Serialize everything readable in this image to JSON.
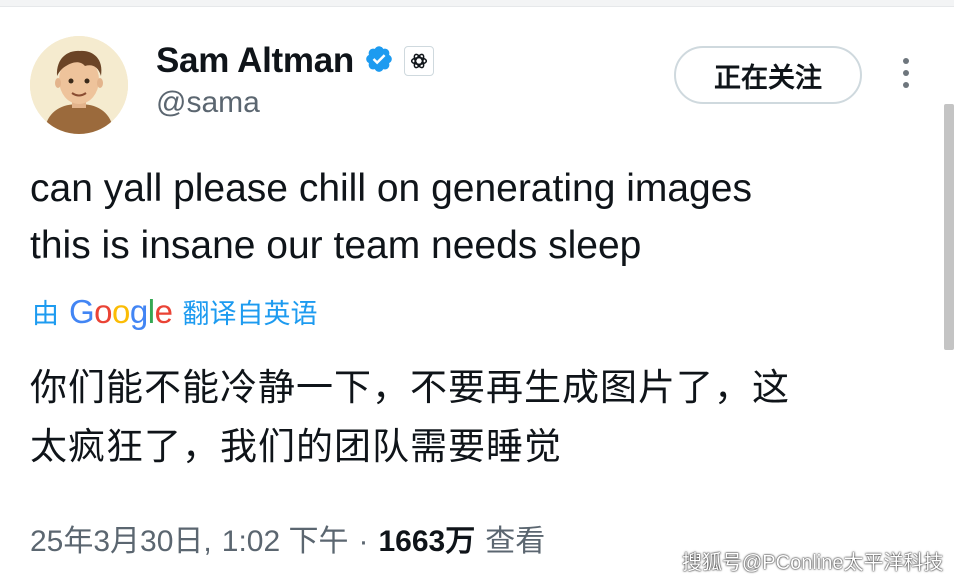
{
  "author": {
    "display_name": "Sam Altman",
    "handle": "@sama",
    "verified_icon": "verified-badge-icon",
    "affiliation_icon": "openai-logo-icon",
    "avatar_icon": "cartoon-avatar"
  },
  "actions": {
    "follow_label": "正在关注",
    "more_icon": "vertical-ellipsis-icon"
  },
  "tweet": {
    "text_en_line1": "can yall please chill on generating images",
    "text_en_line2": "this is insane our team needs sleep",
    "translation_prefix": "由",
    "translation_brand": "Google",
    "translation_suffix": "翻译自英语",
    "text_zh_line1": "你们能不能冷静一下，不要再生成图片了，这",
    "text_zh_line2": "太疯狂了，我们的团队需要睡觉"
  },
  "meta": {
    "date": "25年3月30日,",
    "time": "1:02 下午",
    "separator": "·",
    "views_count": "1663万",
    "views_label": "查看"
  },
  "watermark": "搜狐号@PConline太平洋科技",
  "colors": {
    "link_blue": "#1d9bf0",
    "verified_blue": "#1d9bf0",
    "text_primary": "#0f1419",
    "text_secondary": "#5b6670",
    "google_blue": "#4285f4",
    "google_red": "#ea4335",
    "google_yellow": "#fbbc05",
    "google_green": "#34a853"
  }
}
